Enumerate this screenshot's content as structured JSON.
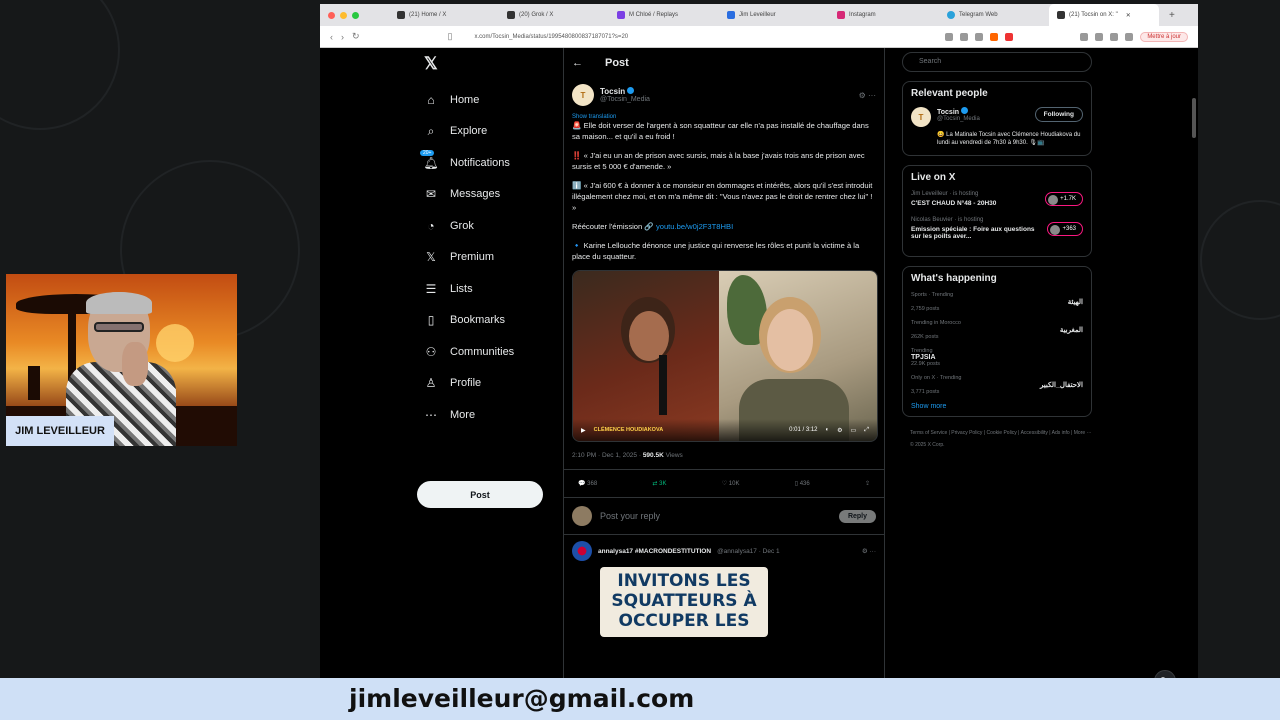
{
  "browser": {
    "tabs": [
      {
        "label": "(21) Home / X"
      },
      {
        "label": "(20) Grok / X"
      },
      {
        "label": "M Chloé / Replays"
      },
      {
        "label": "Jim Leveilleur"
      },
      {
        "label": "Instagram"
      },
      {
        "label": "Telegram Web"
      },
      {
        "label": "(21) Tocsin on X: \""
      }
    ],
    "url": "x.com/Tocsin_Media/status/1995480800837187071?s=20",
    "update_label": "Mettre à jour"
  },
  "x": {
    "nav": [
      {
        "label": "Home",
        "icon": "home-icon"
      },
      {
        "label": "Explore",
        "icon": "search-icon"
      },
      {
        "label": "Notifications",
        "icon": "bell-icon",
        "badge": "20+"
      },
      {
        "label": "Messages",
        "icon": "mail-icon"
      },
      {
        "label": "Grok",
        "icon": "grok-icon"
      },
      {
        "label": "Premium",
        "icon": "x-icon"
      },
      {
        "label": "Lists",
        "icon": "list-icon"
      },
      {
        "label": "Bookmarks",
        "icon": "bookmark-icon"
      },
      {
        "label": "Communities",
        "icon": "people-icon"
      },
      {
        "label": "Profile",
        "icon": "person-icon"
      },
      {
        "label": "More",
        "icon": "more-icon"
      }
    ],
    "post_button": "Post",
    "header_title": "Post",
    "tweet": {
      "author_name": "Tocsin",
      "author_handle": "@Tocsin_Media",
      "show_translation": "Show translation",
      "paragraphs": [
        "🚨 Elle doit verser de l'argent à son squatteur car elle n'a pas installé de chauffage dans sa maison... et qu'il a eu froid !",
        "‼️ « J'ai eu un an de prison avec sursis, mais à la base j'avais trois ans de prison avec sursis et 5 000 € d'amende. »",
        "ℹ️ « J'ai 600 € à donner à ce monsieur en dommages et intérêts, alors qu'il s'est introduit illégalement chez moi, et on m'a même dit : \"Vous n'avez pas le droit de rentrer chez lui\" ! »",
        "🔹 Karine Lellouche dénonce une justice qui renverse les rôles et punit la victime à la place du squatteur."
      ],
      "listen_text": "Réécouter l'émission 🔗",
      "listen_link": "youtu.be/w0j2F3T8HBI",
      "video_caption": "CLÉMENCE HOUDIAKOVA",
      "video_time": "0:01 / 3:12",
      "meta_time": "2:10 PM · Dec 1, 2025 · ",
      "meta_views": "590.5K",
      "meta_views_label": " Views",
      "replies": "368",
      "reposts": "3K",
      "likes": "10K",
      "bookmarks": "436",
      "reply_placeholder": "Post your reply",
      "reply_button": "Reply"
    },
    "reply": {
      "name": "annalysa17 #MACRONDESTITUTION",
      "handle": "@annalysa17 · Dec 1",
      "meme_text": "INVITONS LES SQUATTEURS À OCCUPER LES"
    },
    "right": {
      "search_placeholder": "Search",
      "relevant_title": "Relevant people",
      "relevant_name": "Tocsin",
      "relevant_handle": "@Tocsin_Media",
      "follow_label": "Following",
      "relevant_bio": "😀 La Matinale Tocsin avec Clémence Houdiakova du lundi au vendredi de 7h30 à 9h30. 🎙📺",
      "live_title": "Live on X",
      "live": [
        {
          "who": "Jim Leveilleur · is hosting",
          "title": "C'EST CHAUD N°48 - 20H30",
          "count": "+1.7K"
        },
        {
          "who": "Nicolas Beuvier · is hosting",
          "title": "Emission spéciale : Foire aux questions sur les poilts aver...",
          "count": "+363"
        }
      ],
      "happening_title": "What's happening",
      "trends": [
        {
          "ctx": "Sports · Trending",
          "name": "الهيئة",
          "count": "2,759 posts"
        },
        {
          "ctx": "Trending in Morocco",
          "name": "المغربية",
          "count": "262K posts"
        },
        {
          "ctx": "Trending",
          "name": "TPJSIA",
          "count": "22.9K posts"
        },
        {
          "ctx": "Only on X · Trending",
          "name": "الاحتفال_الكبير",
          "count": "3,771 posts"
        }
      ],
      "show_more": "Show more",
      "footer": "Terms of Service | Privacy Policy | Cookie Policy | Accessibility | Ads info | More ··· © 2025 X Corp."
    }
  },
  "overlay": {
    "presenter_name": "JIM LEVEILLEUR",
    "email": "jimleveilleur@gmail.com"
  }
}
